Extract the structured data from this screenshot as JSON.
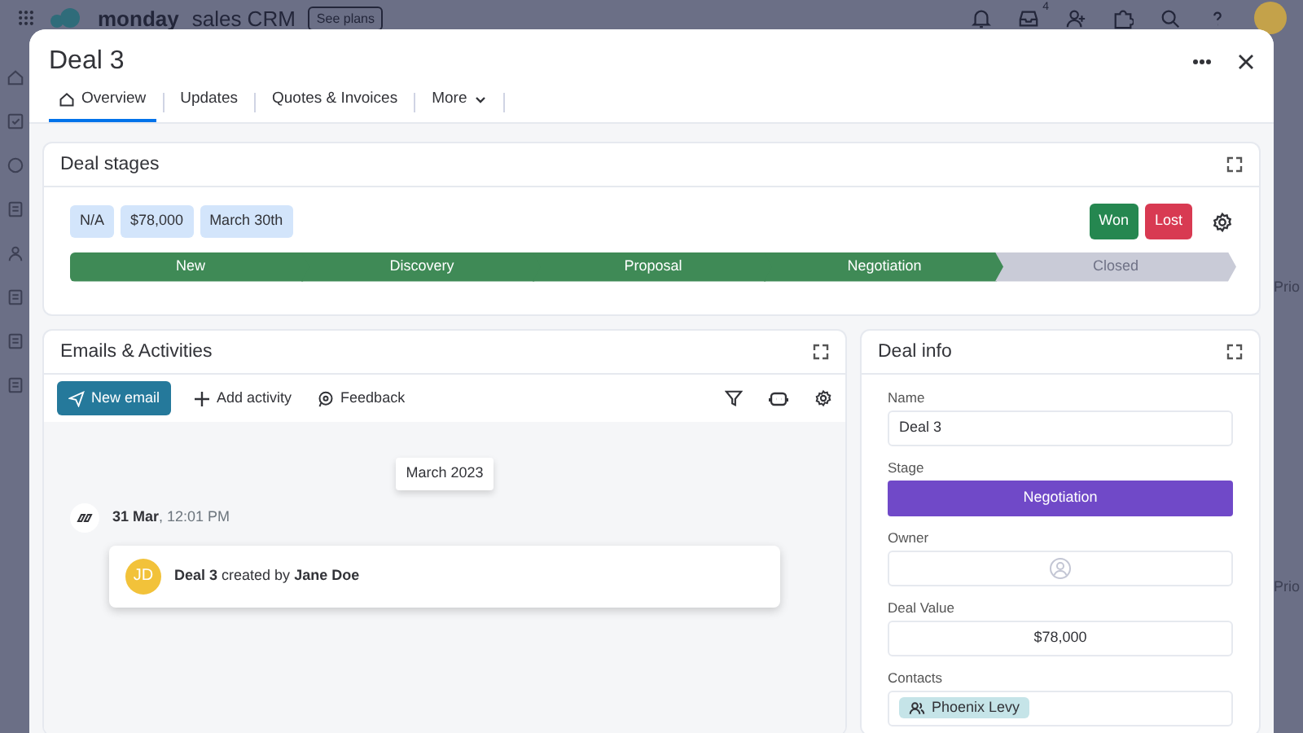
{
  "app_bar": {
    "brand": "monday",
    "product": "sales CRM",
    "plans_button": "See plans",
    "inbox_badge": "4"
  },
  "background_board": {
    "column_labels": [
      "Prio",
      "Prio"
    ]
  },
  "modal": {
    "title": "Deal 3",
    "tabs": [
      {
        "label": "Overview",
        "kind": "home",
        "selected": true
      },
      {
        "label": "Updates",
        "kind": "plain",
        "selected": false
      },
      {
        "label": "Quotes & Invoices",
        "kind": "plain",
        "selected": false
      },
      {
        "label": "More",
        "kind": "dropdown",
        "selected": false
      }
    ]
  },
  "deal_stages": {
    "title": "Deal stages",
    "tags": [
      "N/A",
      "$78,000",
      "March 30th"
    ],
    "won_button": "Won",
    "lost_button": "Lost",
    "stages": [
      {
        "label": "New",
        "reached": true
      },
      {
        "label": "Discovery",
        "reached": true
      },
      {
        "label": "Proposal",
        "reached": true
      },
      {
        "label": "Negotiation",
        "reached": true
      },
      {
        "label": "Closed",
        "reached": false
      }
    ]
  },
  "emails_activities": {
    "title": "Emails & Activities",
    "actions": [
      {
        "label": "New email",
        "kind": "primary"
      },
      {
        "label": "Add activity",
        "kind": "add"
      },
      {
        "label": "Feedback",
        "kind": "feedback"
      }
    ],
    "month": "March 2023",
    "entries": [
      {
        "date": "31 Mar",
        "time": ", 12:01 PM",
        "avatar": "JD",
        "text": "**Deal 3** created by **Jane Doe**"
      }
    ]
  },
  "deal_info": {
    "title": "Deal info",
    "fields": [
      {
        "label": "Name",
        "kind": "text",
        "value": "Deal 3"
      },
      {
        "label": "Stage",
        "kind": "status",
        "value": "Negotiation"
      },
      {
        "label": "Owner",
        "kind": "person"
      },
      {
        "label": "Deal Value",
        "kind": "number",
        "value": "$78,000"
      },
      {
        "label": "Contacts",
        "kind": "chips",
        "chips": [
          "Phoenix Levy"
        ]
      }
    ]
  }
}
